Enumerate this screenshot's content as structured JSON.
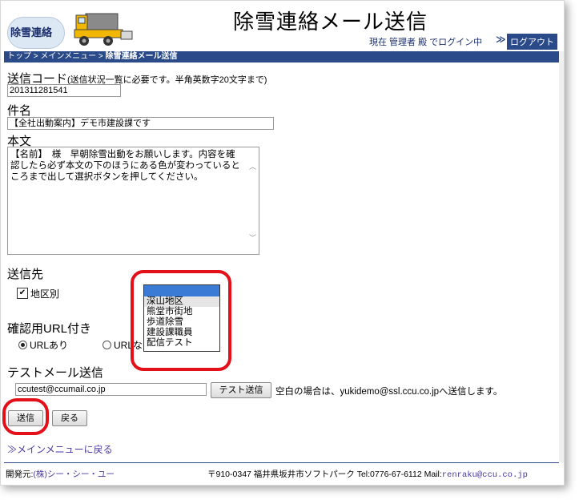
{
  "header": {
    "logo_text": "除雪連絡",
    "title": "除雪連絡メール送信",
    "login_info": "現在 管理者 殿 でログイン中",
    "logout_label": "ログアウト"
  },
  "breadcrumb": {
    "top": "トップ",
    "menu": "メインメニュー",
    "current": "除雪連絡メール送信",
    "sep": ">"
  },
  "form": {
    "code_label": "送信コード",
    "code_hint": "(送信状況一覧に必要です。半角英数字20文字まで)",
    "code_value": "201311281541",
    "subject_label": "件名",
    "subject_value": "【全社出動案内】デモ市建設課です",
    "body_label": "本文",
    "body_value": "【名前】　様　早朝除雪出動をお願いします。内容を確認したら必ず本文の下のほうにある色が変わっているところまで出して選択ボタンを押してください。",
    "dest_label": "送信先",
    "dest_checkbox_label": "地区別",
    "dest_checked": true,
    "dest_options": [
      "",
      "深山地区",
      "熊堂市街地",
      "歩道除雪",
      "建設課職員",
      "配信テスト"
    ],
    "url_label": "確認用URL付き",
    "url_yes_label": "URLあり",
    "url_no_label": "URLなし",
    "test_label": "テストメール送信",
    "test_value": "ccutest@ccumail.co.jp",
    "test_button": "テスト送信",
    "test_note": "空白の場合は、yukidemo@ssl.ccu.co.jpへ送信します。",
    "send_button": "送信",
    "back_button": "戻る"
  },
  "nav": {
    "back_menu_link": "メインメニューに戻る"
  },
  "footer": {
    "dev_label": "開発元:",
    "dev_name": "(株)シー・シー・ユー",
    "address": "〒910-0347 福井県坂井市ソフトパーク Tel:0776-67-6112 Mail:",
    "mail": "renraku@ccu.co.jp"
  },
  "colors": {
    "navy": "#2a4a8a",
    "highlight_ring": "#e3101a",
    "link": "#4a3aa0"
  }
}
